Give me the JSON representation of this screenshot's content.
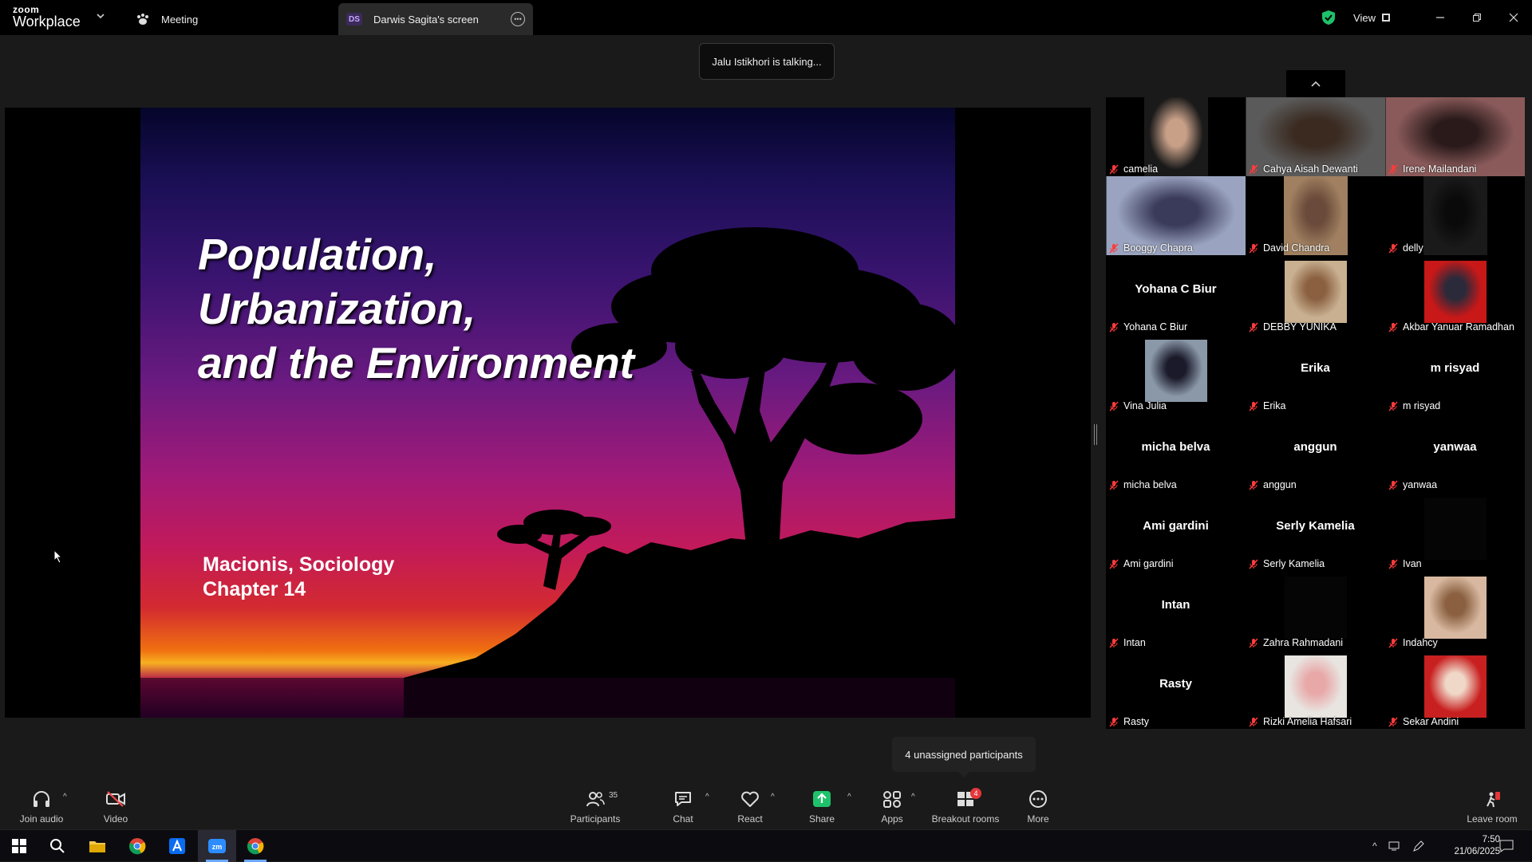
{
  "app": {
    "logo_top": "zoom",
    "logo_bottom": "Workplace"
  },
  "tabs": {
    "meeting": "Meeting",
    "screen_badge": "DS",
    "screen": "Darwis Sagita's screen"
  },
  "window": {
    "view_label": "View"
  },
  "talking_indicator": "Jalu Istikhori is talking...",
  "slide": {
    "title_lines": [
      "Population,",
      "Urbanization,",
      "and the Environment"
    ],
    "subtitle_lines": [
      "Macionis, Sociology",
      "Chapter 14"
    ]
  },
  "gallery": {
    "participants": [
      {
        "name": "camelia",
        "video": true
      },
      {
        "name": "Cahya Aisah Dewanti",
        "video": true
      },
      {
        "name": "Irene Mailandani",
        "video": true
      },
      {
        "name": "Booggy Chapra",
        "video": true
      },
      {
        "name": "David Chandra",
        "video": true
      },
      {
        "name": "delly",
        "video": true
      },
      {
        "name": "Yohana C Biur",
        "video": false
      },
      {
        "name": "DEBBY YUNIKA",
        "video": true
      },
      {
        "name": "Akbar Yanuar Ramadhan",
        "video": true
      },
      {
        "name": "Vina Julia",
        "video": true
      },
      {
        "name": "Erika",
        "video": false
      },
      {
        "name": "m risyad",
        "video": false
      },
      {
        "name": "micha belva",
        "video": false
      },
      {
        "name": "anggun",
        "video": false
      },
      {
        "name": "yanwaa",
        "video": false
      },
      {
        "name": "Ami gardini",
        "video": false
      },
      {
        "name": "Serly Kamelia",
        "video": false
      },
      {
        "name": "Ivan",
        "video": true
      },
      {
        "name": "Intan",
        "video": false
      },
      {
        "name": "Zahra Rahmadani",
        "video": true
      },
      {
        "name": "Indahcy",
        "video": true
      },
      {
        "name": "Rasty",
        "video": false
      },
      {
        "name": "Rizki Amelia Hafsari",
        "video": true
      },
      {
        "name": "Sekar Andini",
        "video": true
      }
    ]
  },
  "unassigned_tooltip": "4 unassigned participants",
  "toolbar": {
    "join_audio": "Join audio",
    "video": "Video",
    "participants": "Participants",
    "participants_count": "35",
    "chat": "Chat",
    "react": "React",
    "share": "Share",
    "apps": "Apps",
    "breakout_rooms": "Breakout rooms",
    "breakout_badge": "4",
    "more": "More",
    "leave_room": "Leave room"
  },
  "taskbar": {
    "time": "7:50",
    "date": "21/06/2025"
  },
  "colors": {
    "share_green": "#1ec26a",
    "mic_off_red": "#ff3b3b",
    "video_off_red": "#ff4a4a",
    "badge_red": "#e5373a"
  }
}
